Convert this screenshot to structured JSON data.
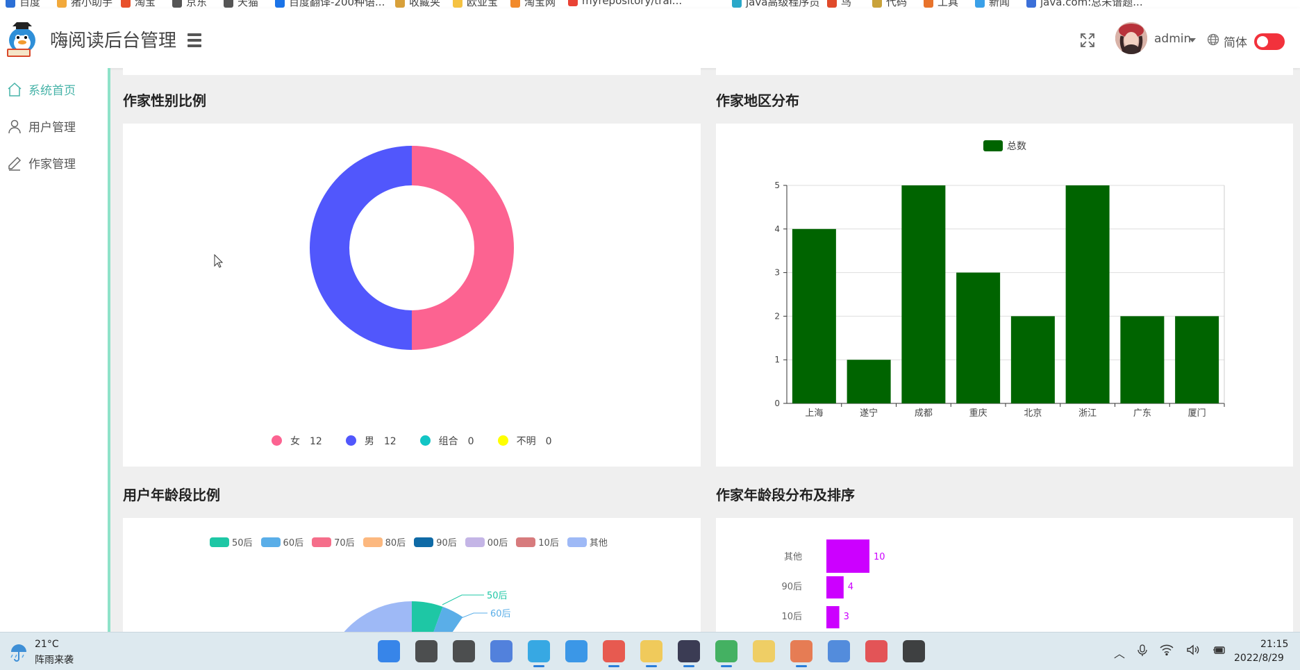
{
  "browser": {
    "bookmarks": [
      "百度",
      "猪小助手",
      "淘宝",
      "京东",
      "天猫",
      "百度翻译-200种语...",
      "收藏夹",
      "欧亚宝",
      "淘宝网",
      "myrepository/trai...",
      "java高级程序员",
      "鸟",
      "代码",
      "工具",
      "新闻",
      "java.com:总未谱题..."
    ]
  },
  "header": {
    "app_title": "嗨阅读后台管理",
    "user_name": "admin",
    "lang_label": "简体"
  },
  "sidebar": {
    "items": [
      {
        "label": "系统首页",
        "icon": "home-icon",
        "active": true
      },
      {
        "label": "用户管理",
        "icon": "user-icon",
        "active": false
      },
      {
        "label": "作家管理",
        "icon": "pen-icon",
        "active": false
      }
    ]
  },
  "sections": {
    "gender": {
      "title": "作家性别比例"
    },
    "region": {
      "title": "作家地区分布"
    },
    "user_age": {
      "title": "用户年龄段比例"
    },
    "author_age": {
      "title": "作家年龄段分布及排序"
    }
  },
  "chart_data": [
    {
      "type": "pie",
      "title": "作家性别比例",
      "donut": true,
      "legend_position": "bottom",
      "slices": [
        {
          "name": "女",
          "value": 12,
          "color": "#fc6391"
        },
        {
          "name": "男",
          "value": 12,
          "color": "#5157fc"
        },
        {
          "name": "组合",
          "value": 0,
          "color": "#12c5c5"
        },
        {
          "name": "不明",
          "value": 0,
          "color": "#ffff00"
        }
      ]
    },
    {
      "type": "bar",
      "title": "作家地区分布",
      "legend_position": "top",
      "grid": true,
      "categories": [
        "上海",
        "遂宁",
        "成都",
        "重庆",
        "北京",
        "浙江",
        "广东",
        "厦门"
      ],
      "series": [
        {
          "name": "总数",
          "values": [
            4,
            1,
            5,
            3,
            2,
            5,
            2,
            2
          ],
          "color": "#006400"
        }
      ],
      "ylim": [
        0,
        5
      ],
      "yticks": [
        0,
        1,
        2,
        3,
        4,
        5
      ]
    },
    {
      "type": "pie",
      "title": "用户年龄段比例",
      "legend_position": "top",
      "legend": [
        {
          "name": "50后",
          "color": "#1ec7a5"
        },
        {
          "name": "60后",
          "color": "#5aaee8"
        },
        {
          "name": "70后",
          "color": "#f56e8a"
        },
        {
          "name": "80后",
          "color": "#fcb87f"
        },
        {
          "name": "90后",
          "color": "#0f6aa6"
        },
        {
          "name": "00后",
          "color": "#c4b5e6"
        },
        {
          "name": "10后",
          "color": "#d77b7d"
        },
        {
          "name": "其他",
          "color": "#9eb9f6"
        }
      ],
      "visible_labels": [
        "50后",
        "60后"
      ]
    },
    {
      "type": "bar",
      "orientation": "horizontal",
      "title": "作家年龄段分布及排序",
      "categories": [
        "其他",
        "90后",
        "10后"
      ],
      "values": [
        10,
        4,
        3
      ],
      "color": "#cc00ff"
    }
  ],
  "taskbar": {
    "temperature": "21°C",
    "weather": "阵雨来袭",
    "time": "21:15",
    "date": "2022/8/29",
    "apps": [
      {
        "name": "start-icon",
        "color": "#1a73e8",
        "active": false
      },
      {
        "name": "search-icon",
        "color": "#333333",
        "active": false
      },
      {
        "name": "task-view-icon",
        "color": "#333333",
        "active": false
      },
      {
        "name": "network-tool-icon",
        "color": "#3a6fd8",
        "active": false
      },
      {
        "name": "edge-icon",
        "color": "#1b9de2",
        "active": true
      },
      {
        "name": "ie-icon",
        "color": "#1e88e5",
        "active": false
      },
      {
        "name": "chrome-icon",
        "color": "#e94235",
        "active": true
      },
      {
        "name": "folder-icon",
        "color": "#f4c542",
        "active": true
      },
      {
        "name": "intellij-icon",
        "color": "#1f1f3a",
        "active": true
      },
      {
        "name": "hbuilder-icon",
        "color": "#2aa84a",
        "active": true
      },
      {
        "name": "yarn-icon",
        "color": "#f2c94c",
        "active": false
      },
      {
        "name": "ppt-icon",
        "color": "#e86a3a",
        "active": true
      },
      {
        "name": "photos-icon",
        "color": "#3b7bd8",
        "active": false
      },
      {
        "name": "wps-icon",
        "color": "#e4393c",
        "active": false
      },
      {
        "name": "terminal-icon",
        "color": "#222222",
        "active": false
      }
    ]
  }
}
